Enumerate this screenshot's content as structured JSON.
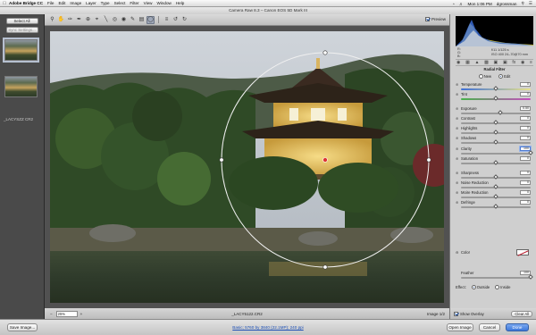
{
  "menubar": {
    "app_name": "Adobe Bridge CC",
    "items": [
      "File",
      "Edit",
      "Image",
      "Layer",
      "Type",
      "Select",
      "Filter",
      "View",
      "Window",
      "Help"
    ],
    "clock": "Mon 1:06 PM",
    "user": "dgrossman"
  },
  "window": {
    "title": "Camera Raw 8.3  –  Canon EOS 5D Mark III"
  },
  "toolbar": {
    "tools": [
      "zoom-icon",
      "hand-icon",
      "white-balance-icon",
      "color-sampler-icon",
      "target-adjust-icon",
      "crop-icon",
      "straighten-icon",
      "spot-removal-icon",
      "red-eye-icon",
      "adjustment-brush-icon",
      "graduated-filter-icon",
      "radial-filter-icon",
      "preferences-icon",
      "rotate-ccw-icon",
      "rotate-cw-icon"
    ],
    "active_tool": "radial-filter-icon",
    "preview_label": "Preview",
    "preview_checked": true
  },
  "filmstrip": {
    "select_all": "Select All",
    "sync_settings": "Sync Settings...",
    "selected_file": "_LACYSZZ CR2"
  },
  "status": {
    "zoom_minus": "−",
    "zoom_plus": "+",
    "zoom": "25%",
    "filename": "_LACY5122.CR2",
    "image_count": "Image 1/2"
  },
  "histogram": {
    "readout_left": [
      "R:",
      "G:",
      "B:"
    ],
    "readout_right_1": "f/11   1/125 s",
    "readout_right_2": "ISO 400   24–70@70 mm"
  },
  "radial_filter": {
    "header": "Radial Filter",
    "mode_new": "New",
    "mode_edit": "Edit",
    "mode": "Edit",
    "sliders": [
      {
        "label": "Temperature",
        "value": "0",
        "position": 0.5,
        "track": "temp"
      },
      {
        "label": "Tint",
        "value": "0",
        "position": 0.5,
        "track": "tint"
      },
      {
        "label": "Exposure",
        "value": "0.50",
        "position": 0.56,
        "track": "gray"
      },
      {
        "label": "Contrast",
        "value": "0",
        "position": 0.5,
        "track": "gray"
      },
      {
        "label": "Highlights",
        "value": "0",
        "position": 0.5,
        "track": "gray"
      },
      {
        "label": "Shadows",
        "value": "0",
        "position": 0.5,
        "track": "gray"
      },
      {
        "label": "Clarity",
        "value": "100",
        "position": 1.0,
        "track": "gray",
        "focused": true
      },
      {
        "label": "Saturation",
        "value": "0",
        "position": 0.5,
        "track": "gray"
      },
      {
        "label": "Sharpness",
        "value": "0",
        "position": 0.5,
        "track": "gray"
      },
      {
        "label": "Noise Reduction",
        "value": "0",
        "position": 0.5,
        "track": "gray"
      },
      {
        "label": "Moire Reduction",
        "value": "0",
        "position": 0.5,
        "track": "gray"
      },
      {
        "label": "Defringe",
        "value": "0",
        "position": 0.5,
        "track": "gray"
      }
    ],
    "color_label": "Color",
    "feather_label": "Feather",
    "feather_value": "100",
    "feather_position": 1.0,
    "effect_label": "Effect:",
    "effect_outside": "Outside",
    "effect_inside": "Inside",
    "effect": "Outside",
    "show_overlay": "Show Overlay",
    "show_overlay_checked": true,
    "clear_all": "Clear All"
  },
  "bottom": {
    "save_image": "Save Image...",
    "workflow_link": "Basic; 5760 by 3840 (22.1MP); 240 ppi",
    "open_image": "Open Image",
    "cancel": "Cancel",
    "done": "Done"
  },
  "colors": {
    "accent": "#3d77da",
    "overlay": "#f0f0f0",
    "panel": "#cfcfcf"
  }
}
